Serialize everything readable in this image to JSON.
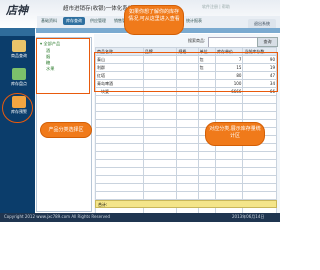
{
  "header": {
    "logo": "店神",
    "title": "超市进销存(收银)一体化系统",
    "top_right": "软件注册 | 帮助"
  },
  "nav": {
    "items": [
      "基础资料",
      "库存查询",
      "供应管理",
      "销售管理",
      "会员管理",
      "财务管理",
      "统计报表"
    ],
    "right_button": "退出系统"
  },
  "sidebar": {
    "items": [
      {
        "label": "商品查询",
        "icon": "box-icon"
      },
      {
        "label": "库存盘点",
        "icon": "chart-icon"
      },
      {
        "label": "库存预警",
        "icon": "alert-icon"
      }
    ]
  },
  "tree": {
    "root": "全部产品",
    "children": [
      "酒",
      "烟",
      "糖",
      "水果"
    ]
  },
  "search": {
    "label": "搜索商品:",
    "value": "",
    "button": "查询"
  },
  "table": {
    "headers": [
      "商品名称",
      "品牌",
      "规格",
      "单位",
      "库存单价",
      "当前库存数"
    ],
    "rows": [
      [
        "泰山",
        "",
        "",
        "包",
        "7",
        "90"
      ],
      [
        "利群",
        "",
        "",
        "包",
        "15",
        "19"
      ],
      [
        "红塔",
        "",
        "",
        "",
        "80",
        "47"
      ],
      [
        "青岛啤酒",
        "",
        "",
        "",
        "100",
        "34"
      ],
      [
        "一块瓷",
        "",
        "",
        "",
        "6666",
        "66"
      ],
      [
        "",
        "",
        "",
        "",
        "",
        ""
      ],
      [
        "",
        "",
        "",
        "",
        "",
        ""
      ],
      [
        "",
        "",
        "",
        "",
        "",
        ""
      ],
      [
        "",
        "",
        "",
        "",
        "",
        ""
      ],
      [
        "",
        "",
        "",
        "",
        "",
        ""
      ],
      [
        "",
        "",
        "",
        "",
        "",
        ""
      ],
      [
        "",
        "",
        "",
        "",
        "",
        ""
      ],
      [
        "",
        "",
        "",
        "",
        "",
        ""
      ],
      [
        "",
        "",
        "",
        "",
        "",
        ""
      ],
      [
        "",
        "",
        "",
        "",
        "",
        ""
      ],
      [
        "",
        "",
        "",
        "",
        "",
        ""
      ],
      [
        "",
        "",
        "",
        "",
        "",
        ""
      ],
      [
        "",
        "",
        "",
        "",
        "",
        ""
      ],
      [
        "",
        "",
        "",
        "",
        "",
        ""
      ],
      [
        "",
        "",
        "",
        "",
        "",
        ""
      ]
    ],
    "total_label": "合计:"
  },
  "annotations": {
    "top": "如果你想了解你的库存情况,可从这里进入查看",
    "left": "产品分类选择区",
    "right": "对应分类,展示库存量统计区"
  },
  "footer": {
    "copyright": "Copyright 2012  www.jxc789.com  All Rights Reserved",
    "right_text": "2013年06月14日"
  },
  "colors": {
    "sidebar": "#0b3d6b",
    "accent": "#f07a1a",
    "highlight": "#e85a0c",
    "total_row": "#f4e58a"
  }
}
